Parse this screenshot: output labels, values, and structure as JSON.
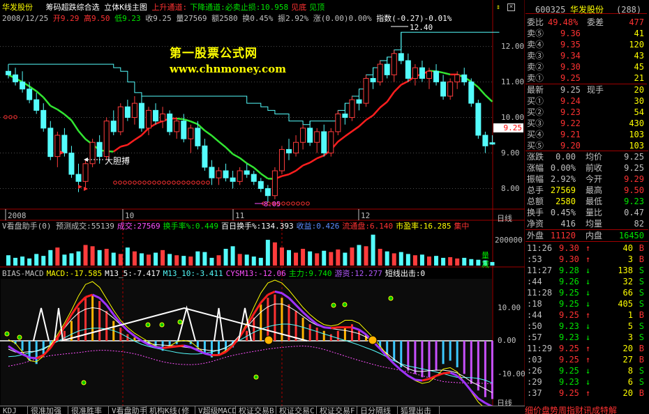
{
  "title_bar": {
    "stock_name": "华发股份",
    "indicator": "筹码超跌综合选",
    "chart_name": "立体K线主图",
    "items": [
      {
        "text": "上升通道:",
        "color": "#ff3232"
      },
      {
        "text": "下降通道:必卖止损:10.958",
        "color": "#00e600"
      },
      {
        "text": "见底",
        "color": "#ff3232"
      },
      {
        "text": "见顶",
        "color": "#00e600"
      }
    ]
  },
  "info_bar": {
    "date": "2008/12/25",
    "open": "开9.29",
    "high": "高9.50",
    "low": "低9.23",
    "close": "收9.25",
    "vol": "量27569",
    "amount": "额2580",
    "turnover": "换0.45%",
    "amplitude": "振2.92%",
    "change": "涨(0.00)0.00%",
    "index": "指数(-0.27)-0.01%"
  },
  "watermark": {
    "line1": "第一股票公式网",
    "line2": "www.chnmoney.com"
  },
  "price_axis": {
    "ticks": [
      "12.00",
      "11.00",
      "10.00",
      "9.00",
      "8.00"
    ],
    "current": "9.25"
  },
  "annotations": {
    "high_label": "12.40",
    "low_label": "8.05",
    "bold_buy": "大胆搏"
  },
  "month_axis": {
    "labels": [
      "2008",
      "10",
      "11",
      "12"
    ],
    "period": "日线"
  },
  "volume_bar": {
    "items": [
      {
        "text": "V看盘助手(0) 预测成交:55139",
        "color": "#c0c0c0"
      },
      {
        "text": "成交:27569",
        "color": "#ff50ff"
      },
      {
        "text": "换手率%:0.449",
        "color": "#00e600"
      },
      {
        "text": "百日换手%:134.393",
        "color": "#ffffff"
      },
      {
        "text": "收益:0.426",
        "color": "#5a8cff"
      },
      {
        "text": "流通盘:6.140",
        "color": "#ff3232"
      },
      {
        "text": "市盈率:16.285",
        "color": "#ffff00"
      },
      {
        "text": "集中",
        "color": "#ff3232"
      }
    ],
    "axis": "200000",
    "tag_up": "量",
    "tag_down": "减"
  },
  "macd_bar": {
    "items": [
      {
        "text": "BIAS-MACD",
        "color": "#c0c0c0"
      },
      {
        "text": "MACD:-17.585",
        "color": "#ffff00"
      },
      {
        "text": "M13_5:-7.417",
        "color": "#ffffff"
      },
      {
        "text": "M13_10:-3.411",
        "color": "#54fcfc"
      },
      {
        "text": "CYSM13:-12.06",
        "color": "#ff50ff"
      },
      {
        "text": "主力:9.740",
        "color": "#00e600"
      },
      {
        "text": "游资:12.277",
        "color": "#b45aff"
      },
      {
        "text": "短线出击:0",
        "color": "#ffffff"
      }
    ],
    "axis": [
      "10.00",
      "0.00",
      "-10.00"
    ],
    "period": "日线"
  },
  "bottom_tabs": [
    "KDJ",
    "很准加强",
    "很准胜率",
    "V看盘助手",
    "机构K线(修",
    "V超级MACD",
    "权证交易B",
    "权证交易C",
    "权证交易F",
    "日分隔线",
    "狐狸出击"
  ],
  "right_footer": "细价盘势周指财讯成特解",
  "quote": {
    "code": "600325",
    "name": "华发股份",
    "number": "(288)",
    "weibi_label": "委比",
    "weibi": "49.48%",
    "weicha_label": "委差",
    "weicha": "477",
    "sell": [
      {
        "label": "卖⑤",
        "price": "9.36",
        "vol": "41"
      },
      {
        "label": "卖④",
        "price": "9.35",
        "vol": "120"
      },
      {
        "label": "卖③",
        "price": "9.34",
        "vol": "43"
      },
      {
        "label": "卖②",
        "price": "9.30",
        "vol": "45"
      },
      {
        "label": "卖①",
        "price": "9.25",
        "vol": "21"
      }
    ],
    "latest_label": "最新",
    "latest": "9.25",
    "hand_label": "现手",
    "hand": "20",
    "buy": [
      {
        "label": "买①",
        "price": "9.24",
        "vol": "30"
      },
      {
        "label": "买②",
        "price": "9.23",
        "vol": "54"
      },
      {
        "label": "买③",
        "price": "9.22",
        "vol": "430"
      },
      {
        "label": "买④",
        "price": "9.21",
        "vol": "103"
      },
      {
        "label": "买⑤",
        "price": "9.20",
        "vol": "103"
      }
    ],
    "stats": [
      {
        "l1": "涨跌",
        "v1": "0.00",
        "c1": "#c0c0c0",
        "l2": "均价",
        "v2": "9.25",
        "c2": "#c0c0c0"
      },
      {
        "l1": "涨幅",
        "v1": "0.00%",
        "c1": "#c0c0c0",
        "l2": "前收",
        "v2": "9.25",
        "c2": "#c0c0c0"
      },
      {
        "l1": "振幅",
        "v1": "2.92%",
        "c1": "#c0c0c0",
        "l2": "今开",
        "v2": "9.29",
        "c2": "#ff3232"
      },
      {
        "l1": "总手",
        "v1": "27569",
        "c1": "#ffff00",
        "l2": "最高",
        "v2": "9.50",
        "c2": "#ff3232"
      },
      {
        "l1": "总额",
        "v1": "2580",
        "c1": "#ffff00",
        "l2": "最低",
        "v2": "9.23",
        "c2": "#00e600"
      },
      {
        "l1": "换手",
        "v1": "0.45%",
        "c1": "#c0c0c0",
        "l2": "量比",
        "v2": "0.47",
        "c2": "#c0c0c0"
      },
      {
        "l1": "外盘",
        "v1": "11120",
        "c1": "#c0c0c0",
        "l2": "内盘",
        "v2": "16450",
        "c2": "#c0c0c0"
      }
    ],
    "jinggu_label": "净资",
    "jinggu": "416",
    "junliang_label": "均量",
    "junliang": "82",
    "trades": [
      {
        "time": "11:26",
        "price": "9.30",
        "dir": "up",
        "vol": "40",
        "side": "B"
      },
      {
        "time": ":53",
        "price": "9.30",
        "dir": "up",
        "vol": "3",
        "side": "B"
      },
      {
        "time": "11:27",
        "price": "9.28",
        "dir": "down",
        "vol": "138",
        "side": "S"
      },
      {
        "time": ":44",
        "price": "9.26",
        "dir": "down",
        "vol": "32",
        "side": "S"
      },
      {
        "time": "11:28",
        "price": "9.25",
        "dir": "down",
        "vol": "66",
        "side": "S"
      },
      {
        "time": ":18",
        "price": "9.25",
        "dir": "down",
        "vol": "405",
        "side": "S"
      },
      {
        "time": ":44",
        "price": "9.25",
        "dir": "up",
        "vol": "1",
        "side": "B"
      },
      {
        "time": ":50",
        "price": "9.23",
        "dir": "down",
        "vol": "5",
        "side": "S"
      },
      {
        "time": ":57",
        "price": "9.23",
        "dir": "down",
        "vol": "3",
        "side": "S"
      },
      {
        "time": "11:29",
        "price": "9.25",
        "dir": "up",
        "vol": "20",
        "side": "B"
      },
      {
        "time": ":03",
        "price": "9.25",
        "dir": "up",
        "vol": "27",
        "side": "B"
      },
      {
        "time": ":26",
        "price": "9.25",
        "dir": "down",
        "vol": "8",
        "side": "S"
      },
      {
        "time": ":29",
        "price": "9.23",
        "dir": "down",
        "vol": "6",
        "side": "S"
      },
      {
        "time": ":37",
        "price": "9.25",
        "dir": "up",
        "vol": "20",
        "side": "B"
      }
    ]
  },
  "chart_data": [
    {
      "type": "candlestick",
      "ylim": [
        7.5,
        12.6
      ],
      "x_labels": [
        "2008",
        "10",
        "11",
        "12"
      ],
      "candles": [
        [
          11.3,
          11.5,
          11.1,
          11.2
        ],
        [
          11.2,
          11.4,
          10.9,
          11.0
        ],
        [
          11.0,
          11.3,
          10.7,
          10.8
        ],
        [
          10.8,
          11.0,
          10.4,
          10.5
        ],
        [
          10.5,
          10.7,
          10.1,
          10.2
        ],
        [
          10.2,
          10.4,
          9.6,
          9.7
        ],
        [
          9.7,
          9.9,
          8.8,
          8.9
        ],
        [
          8.9,
          9.6,
          8.6,
          9.5
        ],
        [
          9.5,
          9.7,
          8.9,
          9.0
        ],
        [
          9.0,
          9.2,
          8.3,
          8.4
        ],
        [
          8.4,
          8.7,
          7.9,
          8.2
        ],
        [
          8.2,
          8.8,
          8.0,
          8.7
        ],
        [
          8.7,
          9.4,
          8.6,
          9.3
        ],
        [
          9.3,
          9.5,
          8.7,
          8.9
        ],
        [
          8.9,
          10.0,
          8.8,
          9.9
        ],
        [
          9.9,
          10.2,
          9.5,
          9.6
        ],
        [
          9.6,
          10.4,
          9.5,
          10.3
        ],
        [
          10.3,
          10.5,
          9.9,
          10.0
        ],
        [
          10.0,
          10.6,
          9.8,
          10.4
        ],
        [
          10.4,
          10.6,
          9.6,
          9.7
        ],
        [
          9.7,
          10.3,
          9.5,
          10.2
        ],
        [
          10.2,
          10.4,
          9.8,
          9.9
        ],
        [
          9.9,
          10.3,
          9.7,
          10.1
        ],
        [
          10.1,
          10.2,
          9.5,
          9.6
        ],
        [
          9.6,
          10.0,
          9.4,
          9.9
        ],
        [
          9.9,
          10.1,
          9.3,
          9.4
        ],
        [
          9.4,
          9.8,
          9.0,
          9.7
        ],
        [
          9.7,
          9.9,
          9.1,
          9.2
        ],
        [
          9.2,
          9.4,
          8.5,
          8.6
        ],
        [
          8.6,
          8.8,
          8.1,
          8.3
        ],
        [
          8.3,
          8.6,
          8.1,
          8.5
        ],
        [
          8.5,
          8.7,
          8.2,
          8.3
        ],
        [
          8.3,
          8.5,
          8.0,
          8.2
        ],
        [
          8.2,
          8.6,
          8.1,
          8.5
        ],
        [
          8.5,
          8.7,
          8.3,
          8.4
        ],
        [
          8.4,
          8.5,
          8.1,
          8.2
        ],
        [
          8.2,
          8.3,
          7.9,
          8.0
        ],
        [
          8.0,
          8.1,
          7.6,
          7.8
        ],
        [
          7.8,
          8.6,
          7.7,
          8.5
        ],
        [
          8.5,
          9.2,
          8.4,
          9.1
        ],
        [
          9.1,
          9.4,
          8.8,
          9.0
        ],
        [
          9.0,
          9.5,
          8.9,
          9.3
        ],
        [
          9.3,
          9.8,
          9.1,
          9.7
        ],
        [
          9.7,
          9.9,
          9.2,
          9.3
        ],
        [
          9.3,
          9.7,
          9.0,
          9.6
        ],
        [
          9.6,
          9.8,
          8.9,
          9.0
        ],
        [
          9.0,
          9.7,
          8.9,
          9.6
        ],
        [
          9.6,
          10.2,
          9.5,
          10.1
        ],
        [
          10.1,
          10.4,
          9.8,
          10.0
        ],
        [
          10.0,
          10.6,
          9.9,
          10.5
        ],
        [
          10.5,
          10.8,
          10.2,
          10.4
        ],
        [
          10.4,
          11.2,
          10.3,
          11.1
        ],
        [
          11.1,
          11.4,
          10.8,
          11.0
        ],
        [
          11.0,
          11.6,
          10.9,
          11.5
        ],
        [
          11.5,
          11.7,
          11.1,
          11.2
        ],
        [
          11.2,
          11.9,
          11.0,
          11.8
        ],
        [
          11.8,
          12.4,
          11.5,
          11.6
        ],
        [
          11.6,
          11.8,
          11.0,
          11.1
        ],
        [
          11.1,
          11.5,
          10.9,
          11.4
        ],
        [
          11.4,
          11.6,
          11.0,
          11.1
        ],
        [
          11.1,
          11.4,
          10.8,
          11.3
        ],
        [
          11.3,
          11.5,
          10.9,
          11.0
        ],
        [
          11.0,
          11.2,
          10.5,
          10.6
        ],
        [
          10.6,
          11.1,
          10.5,
          11.0
        ],
        [
          11.0,
          11.3,
          10.8,
          11.2
        ],
        [
          11.2,
          11.4,
          10.9,
          11.0
        ],
        [
          11.0,
          11.1,
          10.3,
          10.4
        ],
        [
          10.4,
          10.5,
          9.4,
          9.5
        ],
        [
          9.5,
          9.6,
          9.0,
          9.2
        ],
        [
          9.29,
          9.5,
          9.23,
          9.25
        ]
      ]
    },
    {
      "type": "bar",
      "name": "volume",
      "values": [
        80,
        60,
        70,
        55,
        90,
        75,
        120,
        140,
        85,
        95,
        110,
        160,
        150,
        120,
        130,
        100,
        90,
        140,
        110,
        95,
        85,
        100,
        120,
        90,
        80,
        75,
        70,
        110,
        105,
        60,
        80,
        130,
        150,
        90,
        85,
        70,
        60,
        200,
        180,
        140,
        120,
        100,
        130,
        110,
        95,
        115,
        105,
        125,
        100,
        140,
        160,
        150,
        240,
        130,
        110,
        95,
        105,
        90,
        80,
        85,
        70,
        75,
        60,
        65,
        55,
        60,
        50,
        45,
        40,
        27.569
      ],
      "ylim": [
        0,
        260
      ]
    },
    {
      "type": "bar",
      "name": "MACD",
      "values": [
        0,
        -1,
        -3,
        -6,
        -7,
        -4,
        -2,
        1,
        3,
        6,
        10,
        13,
        14,
        12,
        9,
        6,
        4,
        2,
        1,
        0,
        -1,
        -2,
        -3,
        -2,
        -1,
        0,
        -1,
        -2,
        -4,
        -5,
        -4,
        -3,
        -2,
        0,
        3,
        7,
        11,
        13,
        14,
        13,
        11,
        9,
        7,
        5,
        4,
        3,
        2,
        3,
        4,
        5,
        3,
        2,
        0,
        -2,
        -4,
        -6,
        -8,
        -9,
        -10,
        -11,
        -11,
        -9,
        -7,
        -6,
        -8,
        -10,
        -13,
        -15,
        -17,
        -17.585
      ],
      "ylim": [
        -18,
        18
      ],
      "ticks": [
        10,
        0,
        -10
      ]
    }
  ]
}
